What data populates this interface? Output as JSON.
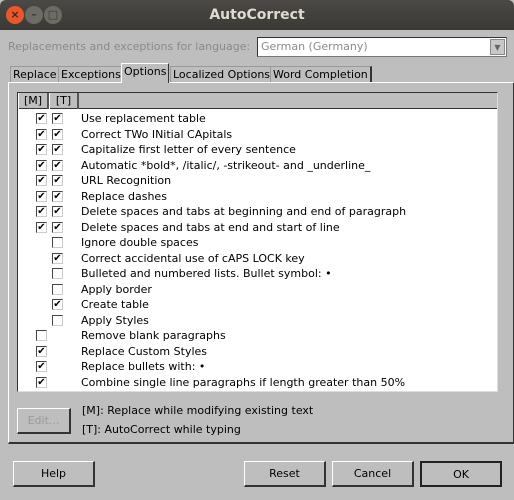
{
  "window": {
    "title": "AutoCorrect",
    "close": "×",
    "minimize": "–",
    "maximize": "□"
  },
  "language": {
    "label": "Replacements and exceptions for language:",
    "value": "German (Germany)"
  },
  "tabs": [
    {
      "label": "Replace"
    },
    {
      "label": "Exceptions"
    },
    {
      "label": "Options",
      "active": true
    },
    {
      "label": "Localized Options"
    },
    {
      "label": "Word Completion"
    }
  ],
  "list": {
    "headers": [
      "[M]",
      "[T]"
    ],
    "rows": [
      {
        "label": "Use replacement table",
        "m": true,
        "t": true
      },
      {
        "label": "Correct TWo INitial CApitals",
        "m": true,
        "t": true
      },
      {
        "label": "Capitalize first letter of every sentence",
        "m": true,
        "t": true
      },
      {
        "label": "Automatic *bold*, /italic/, -strikeout- and _underline_",
        "m": true,
        "t": true
      },
      {
        "label": "URL Recognition",
        "m": true,
        "t": true
      },
      {
        "label": "Replace dashes",
        "m": true,
        "t": true
      },
      {
        "label": "Delete spaces and tabs at beginning and end of paragraph",
        "m": true,
        "t": true
      },
      {
        "label": "Delete spaces and tabs at end and start of line",
        "m": true,
        "t": true
      },
      {
        "label": "Ignore double spaces",
        "m": null,
        "t": false
      },
      {
        "label": "Correct accidental use of cAPS LOCK key",
        "m": null,
        "t": true
      },
      {
        "label": "Bulleted and numbered lists. Bullet symbol: •",
        "m": null,
        "t": false
      },
      {
        "label": "Apply border",
        "m": null,
        "t": false
      },
      {
        "label": "Create table",
        "m": null,
        "t": true
      },
      {
        "label": "Apply Styles",
        "m": null,
        "t": false
      },
      {
        "label": "Remove blank paragraphs",
        "m": false,
        "t": null
      },
      {
        "label": "Replace Custom Styles",
        "m": true,
        "t": null
      },
      {
        "label": "Replace bullets with: •",
        "m": true,
        "t": null
      },
      {
        "label": "Combine single line paragraphs if length greater than 50%",
        "m": true,
        "t": null
      }
    ]
  },
  "edit_button": "Edit...",
  "legend": {
    "m": "[M]: Replace while modifying existing text",
    "t": "[T]: AutoCorrect while typing"
  },
  "buttons": {
    "help": "Help",
    "reset": "Reset",
    "cancel": "Cancel",
    "ok": "OK"
  },
  "check_glyph": "✔"
}
